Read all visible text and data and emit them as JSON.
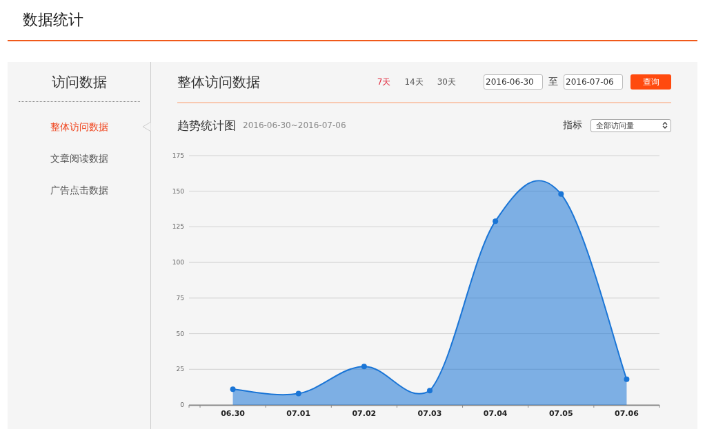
{
  "page_title": "数据统计",
  "sidebar": {
    "title": "访问数据",
    "items": [
      {
        "label": "整体访问数据",
        "selected": true
      },
      {
        "label": "文章阅读数据",
        "selected": false
      },
      {
        "label": "广告点击数据",
        "selected": false
      }
    ]
  },
  "content": {
    "title": "整体访问数据",
    "ranges": [
      {
        "label": "7天",
        "selected": true
      },
      {
        "label": "14天",
        "selected": false
      },
      {
        "label": "30天",
        "selected": false
      }
    ],
    "date_from": "2016-06-30",
    "date_sep": "至",
    "date_to": "2016-07-06",
    "query_button": "查询",
    "chart_title": "趋势统计图",
    "chart_period": "2016-06-30~2016-07-06",
    "metric_label": "指标",
    "chart_data": {
      "type": "area",
      "categories": [
        "06.30",
        "07.01",
        "07.02",
        "07.03",
        "07.04",
        "07.05",
        "07.06"
      ],
      "series": [
        {
          "name": "全部访问量",
          "color": "#1a75d6",
          "values": [
            11,
            8,
            27,
            10,
            129,
            148,
            18
          ]
        }
      ],
      "grid": true,
      "ylim": [
        0,
        175
      ],
      "yticks": [
        0,
        25,
        50,
        75,
        100,
        125,
        150,
        175
      ]
    }
  }
}
